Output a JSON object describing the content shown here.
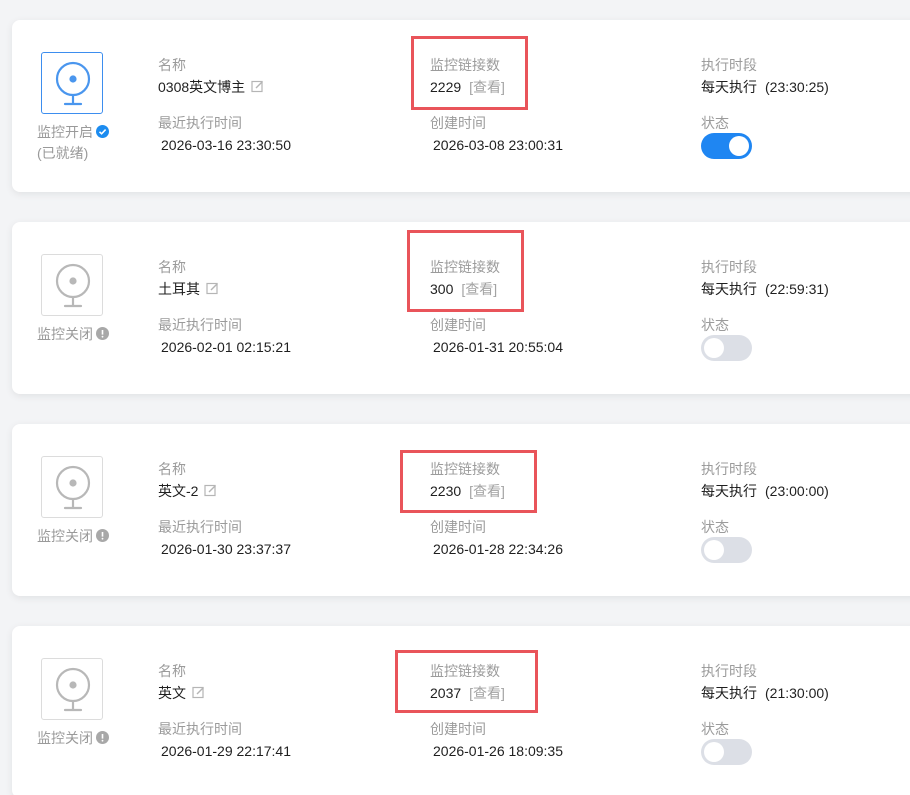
{
  "labels": {
    "name": "名称",
    "link_count": "监控链接数",
    "schedule": "执行时段",
    "last_run": "最近执行时间",
    "created": "创建时间",
    "status": "状态",
    "view": "[查看]"
  },
  "colors": {
    "accent": "#1f86f2",
    "highlight": "#e9545a",
    "muted": "#9b9b9b",
    "toggle_off": "#dcdfe6"
  },
  "icons": {
    "camera": "webcam-icon",
    "edit": "edit-icon",
    "status_ok": "check-circle-icon",
    "status_off": "exclamation-circle-icon"
  },
  "monitors": [
    {
      "status_line1": "监控开启",
      "status_line2": "(已就绪)",
      "enabled": true,
      "name": "0308英文博主",
      "link_count": "2229",
      "schedule_prefix": "每天执行",
      "schedule_time": "(23:30:25)",
      "last_run": "2026-03-16 23:30:50",
      "created": "2026-03-08 23:00:31"
    },
    {
      "status_line1": "监控关闭",
      "status_line2": "",
      "enabled": false,
      "name": "土耳其",
      "link_count": "300",
      "schedule_prefix": "每天执行",
      "schedule_time": "(22:59:31)",
      "last_run": "2026-02-01 02:15:21",
      "created": "2026-01-31 20:55:04"
    },
    {
      "status_line1": "监控关闭",
      "status_line2": "",
      "enabled": false,
      "name": "英文-2",
      "link_count": "2230",
      "schedule_prefix": "每天执行",
      "schedule_time": "(23:00:00)",
      "last_run": "2026-01-30 23:37:37",
      "created": "2026-01-28 22:34:26"
    },
    {
      "status_line1": "监控关闭",
      "status_line2": "",
      "enabled": false,
      "name": "英文",
      "link_count": "2037",
      "schedule_prefix": "每天执行",
      "schedule_time": "(21:30:00)",
      "last_run": "2026-01-29 22:17:41",
      "created": "2026-01-26 18:09:35"
    }
  ]
}
